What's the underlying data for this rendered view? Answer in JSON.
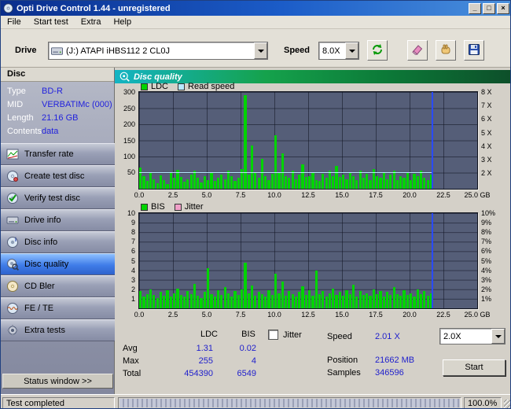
{
  "window": {
    "title": "Opti Drive Control 1.44 - unregistered",
    "minimize": "_",
    "maximize": "□",
    "close": "×"
  },
  "menu": {
    "items": [
      "File",
      "Start test",
      "Extra",
      "Help"
    ]
  },
  "toolbar": {
    "drive_label": "Drive",
    "drive_value": "(J:)  ATAPI  iHBS112   2 CL0J",
    "speed_label": "Speed",
    "speed_value": "8.0X"
  },
  "sidebar": {
    "section_title": "Disc",
    "info": [
      {
        "label": "Type",
        "value": "BD-R"
      },
      {
        "label": "MID",
        "value": "VERBATIMc (000)"
      },
      {
        "label": "Length",
        "value": "21.16 GB"
      },
      {
        "label": "Contents",
        "value": "data"
      }
    ],
    "buttons": [
      {
        "label": "Transfer rate"
      },
      {
        "label": "Create test disc"
      },
      {
        "label": "Verify test disc"
      },
      {
        "label": "Drive info"
      },
      {
        "label": "Disc info"
      },
      {
        "label": "Disc quality",
        "selected": true
      },
      {
        "label": "CD Bler"
      },
      {
        "label": "FE / TE"
      },
      {
        "label": "Extra tests"
      }
    ],
    "status_window_label": "Status window >>"
  },
  "main": {
    "header": "Disc quality"
  },
  "stats": {
    "col1": "LDC",
    "col2": "BIS",
    "jitter_label": "Jitter",
    "jitter_checked": false,
    "rows": [
      {
        "label": "Avg",
        "ldc": "1.31",
        "bis": "0.02"
      },
      {
        "label": "Max",
        "ldc": "255",
        "bis": "4"
      },
      {
        "label": "Total",
        "ldc": "454390",
        "bis": "6549"
      }
    ],
    "speed_label": "Speed",
    "speed_value": "2.01 X",
    "speed_select": "2.0X",
    "position_label": "Position",
    "position_value": "21662 MB",
    "samples_label": "Samples",
    "samples_value": "346596",
    "start_label": "Start"
  },
  "statusbar": {
    "text": "Test completed",
    "progress": "100.0%"
  },
  "colors": {
    "bar_green": "#00d400",
    "read_speed_cyan": "#b8e8ff",
    "jitter_pink": "#f0a0c8",
    "value_blue": "#2020cc",
    "position_line_blue": "#2a4bff"
  },
  "chart_data": [
    {
      "type": "bar",
      "name": "ldc-read-speed",
      "legend": [
        {
          "label": "LDC",
          "color": "#00d400"
        },
        {
          "label": "Read speed",
          "color": "#b8e8ff"
        }
      ],
      "x_unit": "GB",
      "x_step_gb": 0.25,
      "xlim": [
        0,
        25
      ],
      "ylim": [
        0,
        300
      ],
      "xticks": [
        {
          "label": "0.0",
          "frac": 0
        },
        {
          "label": "2.5",
          "frac": 0.1
        },
        {
          "label": "5.0",
          "frac": 0.2
        },
        {
          "label": "7.5",
          "frac": 0.3
        },
        {
          "label": "10.0",
          "frac": 0.4
        },
        {
          "label": "12.5",
          "frac": 0.5
        },
        {
          "label": "15.0",
          "frac": 0.6
        },
        {
          "label": "17.5",
          "frac": 0.7
        },
        {
          "label": "20.0",
          "frac": 0.8
        },
        {
          "label": "22.5",
          "frac": 0.9
        },
        {
          "label": "25.0 GB",
          "frac": 1
        }
      ],
      "yticks_left": [
        {
          "label": "300",
          "frac": 1
        },
        {
          "label": "250",
          "frac": 0.8333
        },
        {
          "label": "200",
          "frac": 0.6667
        },
        {
          "label": "150",
          "frac": 0.5
        },
        {
          "label": "100",
          "frac": 0.3333
        },
        {
          "label": "50",
          "frac": 0.1667
        }
      ],
      "yticks_right": [
        {
          "label": "8 X",
          "frac": 1
        },
        {
          "label": "7 X",
          "frac": 0.86
        },
        {
          "label": "6 X",
          "frac": 0.72
        },
        {
          "label": "5 X",
          "frac": 0.58
        },
        {
          "label": "4 X",
          "frac": 0.44
        },
        {
          "label": "3 X",
          "frac": 0.3
        },
        {
          "label": "2 X",
          "frac": 0.16
        }
      ],
      "bar_color": "#00d400",
      "values": [
        65,
        38,
        25,
        52,
        30,
        18,
        42,
        28,
        15,
        48,
        33,
        58,
        36,
        22,
        30,
        45,
        55,
        33,
        20,
        40,
        28,
        50,
        24,
        35,
        44,
        30,
        56,
        38,
        24,
        34,
        60,
        290,
        45,
        135,
        50,
        34,
        92,
        40,
        28,
        46,
        165,
        52,
        110,
        40,
        34,
        56,
        30,
        44,
        75,
        36,
        40,
        50,
        28,
        24,
        46,
        34,
        56,
        40,
        70,
        36,
        44,
        30,
        50,
        40,
        26,
        55,
        34,
        46,
        28,
        60,
        40,
        34,
        50,
        30,
        44,
        56,
        26,
        40,
        34,
        50,
        28,
        46,
        40,
        55,
        34,
        28,
        44
      ],
      "read_speed_line": {
        "value": "2.01 X",
        "y_frac": 0.165,
        "x_end_frac": 0.866,
        "color": "#b8e8ff"
      },
      "position_line": {
        "gb": 21.66,
        "x_frac": 0.866,
        "color": "#2a4bff"
      }
    },
    {
      "type": "bar",
      "name": "bis-jitter",
      "legend": [
        {
          "label": "BIS",
          "color": "#00d400"
        },
        {
          "label": "Jitter",
          "color": "#f0a0c8"
        }
      ],
      "x_unit": "GB",
      "x_step_gb": 0.25,
      "xlim": [
        0,
        25
      ],
      "ylim": [
        0,
        10
      ],
      "xticks": [
        {
          "label": "0.0",
          "frac": 0
        },
        {
          "label": "2.5",
          "frac": 0.1
        },
        {
          "label": "5.0",
          "frac": 0.2
        },
        {
          "label": "7.5",
          "frac": 0.3
        },
        {
          "label": "10.0",
          "frac": 0.4
        },
        {
          "label": "12.5",
          "frac": 0.5
        },
        {
          "label": "15.0",
          "frac": 0.6
        },
        {
          "label": "17.5",
          "frac": 0.7
        },
        {
          "label": "20.0",
          "frac": 0.8
        },
        {
          "label": "22.5",
          "frac": 0.9
        },
        {
          "label": "25.0 GB",
          "frac": 1
        }
      ],
      "yticks_left": [
        {
          "label": "10",
          "frac": 1
        },
        {
          "label": "9",
          "frac": 0.9
        },
        {
          "label": "8",
          "frac": 0.8
        },
        {
          "label": "7",
          "frac": 0.7
        },
        {
          "label": "6",
          "frac": 0.6
        },
        {
          "label": "5",
          "frac": 0.5
        },
        {
          "label": "4",
          "frac": 0.4
        },
        {
          "label": "3",
          "frac": 0.3
        },
        {
          "label": "2",
          "frac": 0.2
        },
        {
          "label": "1",
          "frac": 0.1
        }
      ],
      "yticks_right": [
        {
          "label": "10%",
          "frac": 1
        },
        {
          "label": "9%",
          "frac": 0.9
        },
        {
          "label": "8%",
          "frac": 0.8
        },
        {
          "label": "7%",
          "frac": 0.7
        },
        {
          "label": "6%",
          "frac": 0.6
        },
        {
          "label": "5%",
          "frac": 0.5
        },
        {
          "label": "4%",
          "frac": 0.4
        },
        {
          "label": "3%",
          "frac": 0.3
        },
        {
          "label": "2%",
          "frac": 0.2
        },
        {
          "label": "1%",
          "frac": 0.1
        }
      ],
      "bar_color": "#00d400",
      "values": [
        1.8,
        1.2,
        1.5,
        2.0,
        1.4,
        1.1,
        1.7,
        1.3,
        1.9,
        1.2,
        1.6,
        2.1,
        1.4,
        1.2,
        1.8,
        1.5,
        2.6,
        1.3,
        1.1,
        1.7,
        4.2,
        1.5,
        1.2,
        1.9,
        1.4,
        2.2,
        1.6,
        1.2,
        1.8,
        1.4,
        2.0,
        4.8,
        1.6,
        2.4,
        1.3,
        1.7,
        1.5,
        1.2,
        1.9,
        1.4,
        3.6,
        1.6,
        2.8,
        1.3,
        1.8,
        1.5,
        1.2,
        1.7,
        2.3,
        1.4,
        1.9,
        1.3,
        4.0,
        1.5,
        1.8,
        1.2,
        1.6,
        2.1,
        1.4,
        1.7,
        1.3,
        1.9,
        1.5,
        2.5,
        1.2,
        1.8,
        1.4,
        1.6,
        1.3,
        2.0,
        1.5,
        1.8,
        1.2,
        1.7,
        1.4,
        2.2,
        1.5,
        1.3,
        1.9,
        1.4,
        1.6,
        1.2,
        2.0,
        1.5,
        1.8,
        1.3,
        1.6
      ],
      "position_line": {
        "gb": 21.66,
        "x_frac": 0.866,
        "color": "#2a4bff"
      }
    }
  ]
}
